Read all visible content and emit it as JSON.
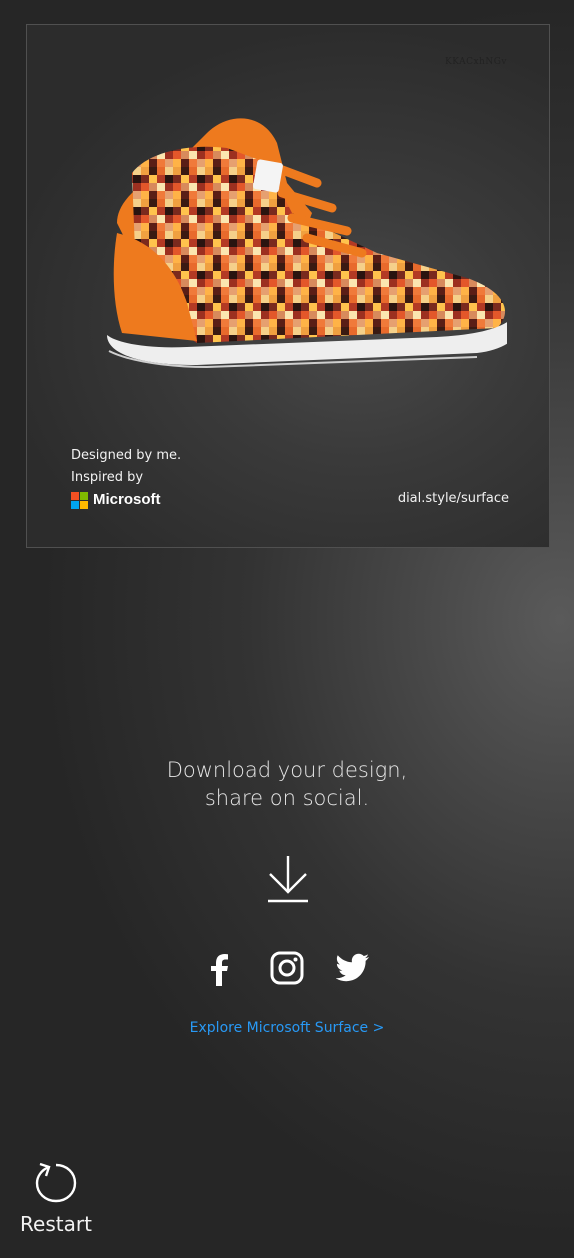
{
  "card": {
    "code": "KKACxhNGv",
    "credit_line1": "Designed by me.",
    "credit_line2": "Inspired by",
    "brand": "Microsoft",
    "site": "dial.style/surface"
  },
  "headline": {
    "line1": "Download your design,",
    "line2": "share on social."
  },
  "actions": {
    "download_icon": "download-icon",
    "social": [
      {
        "name": "facebook",
        "icon": "facebook-icon"
      },
      {
        "name": "instagram",
        "icon": "instagram-icon"
      },
      {
        "name": "twitter",
        "icon": "twitter-icon"
      }
    ]
  },
  "explore_link": "Explore Microsoft Surface >",
  "restart": {
    "label": "Restart",
    "icon": "restart-icon"
  },
  "colors": {
    "accent_link": "#2899f5",
    "shoe_orange": "#ee7a1e",
    "ms_red": "#f25022",
    "ms_green": "#7fba00",
    "ms_blue": "#00a4ef",
    "ms_yellow": "#ffb900"
  }
}
